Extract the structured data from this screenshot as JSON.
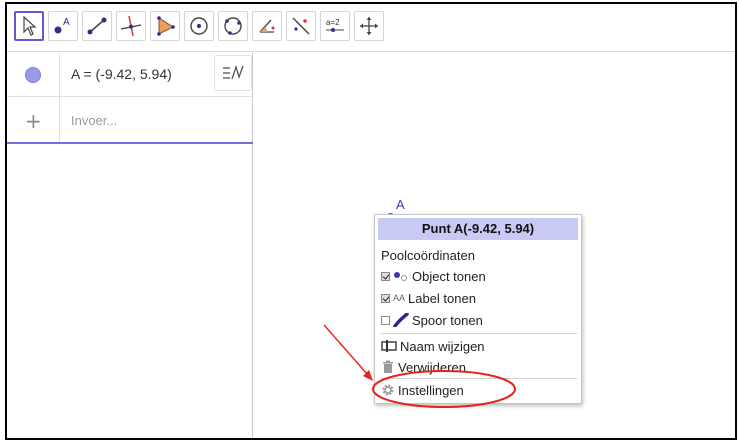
{
  "colors": {
    "accent": "#6557d2",
    "point": "#3a3ab8",
    "marble": "#9a9ae6",
    "menu_title_bg": "#c9c9f5",
    "annotation": "#e8231f"
  },
  "toolbar": {
    "tools": [
      {
        "id": "move",
        "icon": "arrow-cursor-icon"
      },
      {
        "id": "point",
        "icon": "point-icon"
      },
      {
        "id": "segment",
        "icon": "segment-icon"
      },
      {
        "id": "perpendicular",
        "icon": "perpendicular-line-icon"
      },
      {
        "id": "polygon",
        "icon": "polygon-icon"
      },
      {
        "id": "circle",
        "icon": "circle-center-icon"
      },
      {
        "id": "circle3",
        "icon": "circle-three-points-icon"
      },
      {
        "id": "angle",
        "icon": "angle-icon"
      },
      {
        "id": "reflect",
        "icon": "reflect-line-icon"
      },
      {
        "id": "slider",
        "icon": "slider-icon",
        "label": "a=2"
      },
      {
        "id": "move-graphics",
        "icon": "move-graphics-icon"
      }
    ]
  },
  "algebra": {
    "item_value": "A = (-9.42, 5.94)",
    "input_placeholder": "Invoer..."
  },
  "graphics": {
    "point_label": "A"
  },
  "context_menu": {
    "title": "Punt A(-9.42, 5.94)",
    "items": [
      {
        "label": "Poolcoördinaten"
      },
      {
        "label": "Object tonen",
        "checked": true
      },
      {
        "label": "Label tonen",
        "checked": true,
        "glyph": "AA"
      },
      {
        "label": "Spoor tonen",
        "checked": false
      },
      {
        "label": "Naam wijzigen"
      },
      {
        "label": "Verwijderen"
      },
      {
        "label": "Instellingen"
      }
    ]
  }
}
